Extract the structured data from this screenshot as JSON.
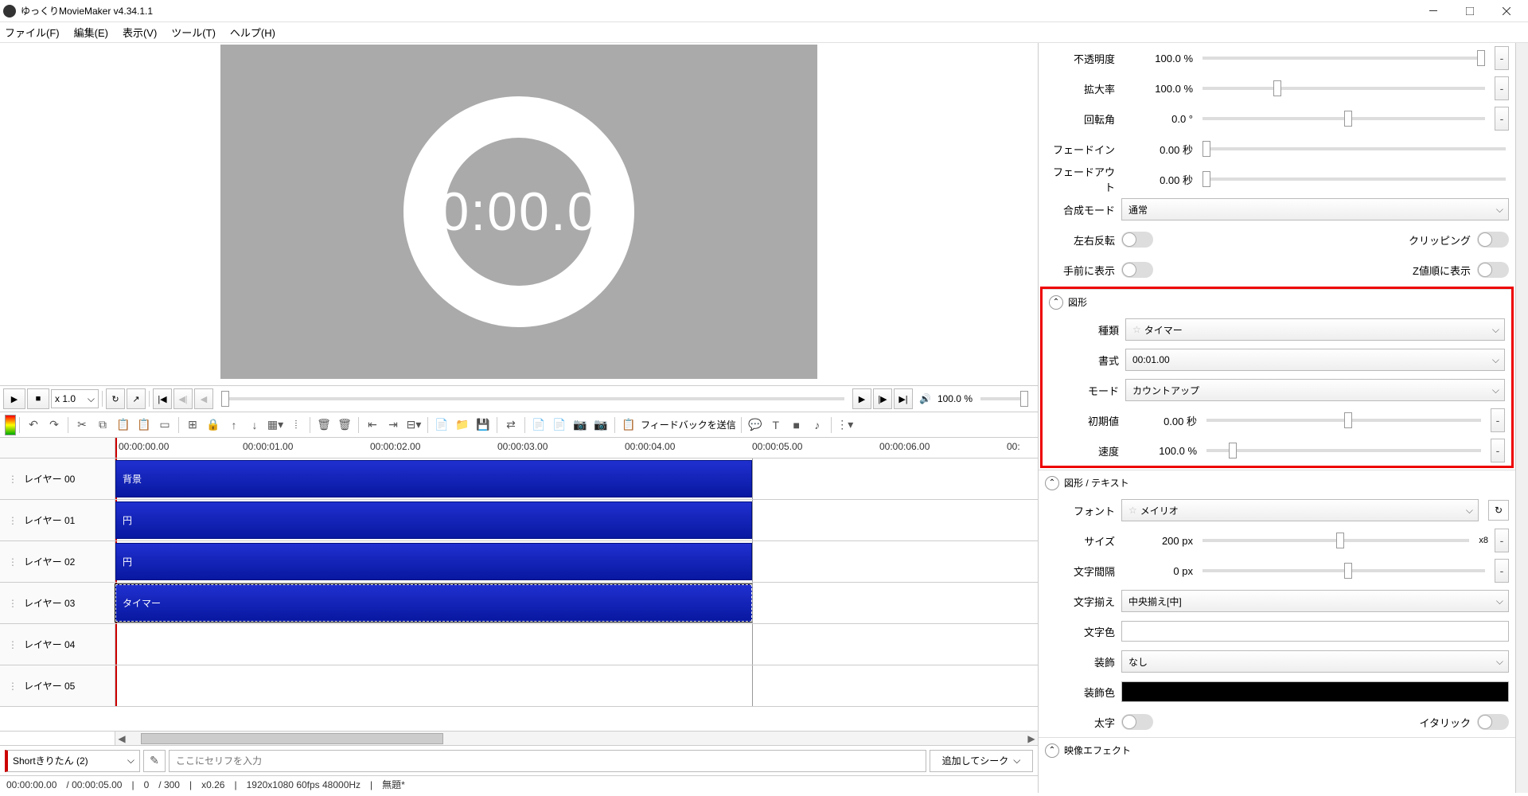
{
  "window": {
    "title": "ゆっくりMovieMaker v4.34.1.1"
  },
  "menu": {
    "file": "ファイル(F)",
    "edit": "編集(E)",
    "view": "表示(V)",
    "tool": "ツール(T)",
    "help": "ヘルプ(H)"
  },
  "preview": {
    "timer_text": "0:00.0"
  },
  "playbar": {
    "speed": "x 1.0",
    "volume": "100.0 %"
  },
  "toolbar2": {
    "feedback": "フィードバックを送信"
  },
  "ruler": {
    "t0": "00:00:00.00",
    "t1": "00:00:01.00",
    "t2": "00:00:02.00",
    "t3": "00:00:03.00",
    "t4": "00:00:04.00",
    "t5": "00:00:05.00",
    "t6": "00:00:06.00",
    "t7": "00:"
  },
  "layers": {
    "l0": {
      "name": "レイヤー 00",
      "clip": "背景"
    },
    "l1": {
      "name": "レイヤー 01",
      "clip": "円"
    },
    "l2": {
      "name": "レイヤー 02",
      "clip": "円"
    },
    "l3": {
      "name": "レイヤー 03",
      "clip": "タイマー"
    },
    "l4": {
      "name": "レイヤー 04"
    },
    "l5": {
      "name": "レイヤー 05"
    }
  },
  "bottom": {
    "character": "Shortきりたん (2)",
    "placeholder": "ここにセリフを入力",
    "add_seek": "追加してシーク"
  },
  "status": {
    "cur": "00:00:00.00",
    "dur": "/ 00:00:05.00",
    "frame": "0",
    "frames": "/ 300",
    "zoom": "x0.26",
    "res": "1920x1080 60fps 48000Hz",
    "proj": "無題*"
  },
  "props": {
    "opacity": {
      "label": "不透明度",
      "val": "100.0 %"
    },
    "scale": {
      "label": "拡大率",
      "val": "100.0 %"
    },
    "rotation": {
      "label": "回転角",
      "val": "0.0 °"
    },
    "fadein": {
      "label": "フェードイン",
      "val": "0.00 秒"
    },
    "fadeout": {
      "label": "フェードアウト",
      "val": "0.00 秒"
    },
    "blend": {
      "label": "合成モード",
      "val": "通常"
    },
    "fliph": {
      "label": "左右反転"
    },
    "clip": {
      "label": "クリッピング"
    },
    "front": {
      "label": "手前に表示"
    },
    "zorder": {
      "label": "Z値順に表示"
    },
    "shape_section": "図形",
    "type": {
      "label": "種類",
      "val": "タイマー"
    },
    "format": {
      "label": "書式",
      "val": "00:01.00"
    },
    "mode": {
      "label": "モード",
      "val": "カウントアップ"
    },
    "initial": {
      "label": "初期値",
      "val": "0.00 秒"
    },
    "speed": {
      "label": "速度",
      "val": "100.0 %"
    },
    "text_section": "図形 / テキスト",
    "font": {
      "label": "フォント",
      "val": "メイリオ"
    },
    "size": {
      "label": "サイズ",
      "val": "200 px",
      "mult": "x8"
    },
    "spacing": {
      "label": "文字間隔",
      "val": "0 px"
    },
    "align": {
      "label": "文字揃え",
      "val": "中央揃え[中]"
    },
    "color": {
      "label": "文字色"
    },
    "deco": {
      "label": "装飾",
      "val": "なし"
    },
    "decocolor": {
      "label": "装飾色"
    },
    "bold": {
      "label": "太字"
    },
    "italic": {
      "label": "イタリック"
    },
    "effect_section": "映像エフェクト"
  }
}
